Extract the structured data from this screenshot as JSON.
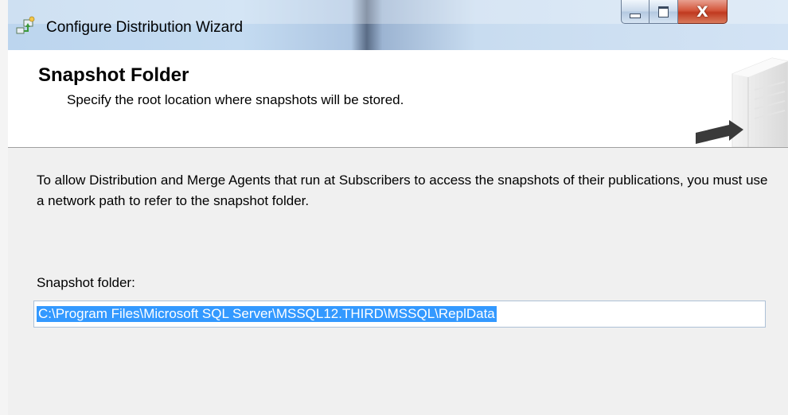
{
  "window": {
    "title": "Configure Distribution Wizard",
    "icon": "wizard-app-icon",
    "controls": [
      "minimize-icon",
      "maximize-icon",
      "close-icon"
    ],
    "close_glyph": "X"
  },
  "header": {
    "title": "Snapshot Folder",
    "subtitle": "Specify the root location where snapshots will be stored.",
    "art": "server-tower-icon"
  },
  "content": {
    "description": "To allow Distribution and Merge Agents that run at Subscribers to access the snapshots of their publications, you must use a network path to refer to the snapshot folder.",
    "snapshot_folder_label": "Snapshot folder:",
    "snapshot_folder_value": "C:\\Program Files\\Microsoft SQL Server\\MSSQL12.THIRD\\MSSQL\\ReplData",
    "selection_color": "#3399ff"
  }
}
